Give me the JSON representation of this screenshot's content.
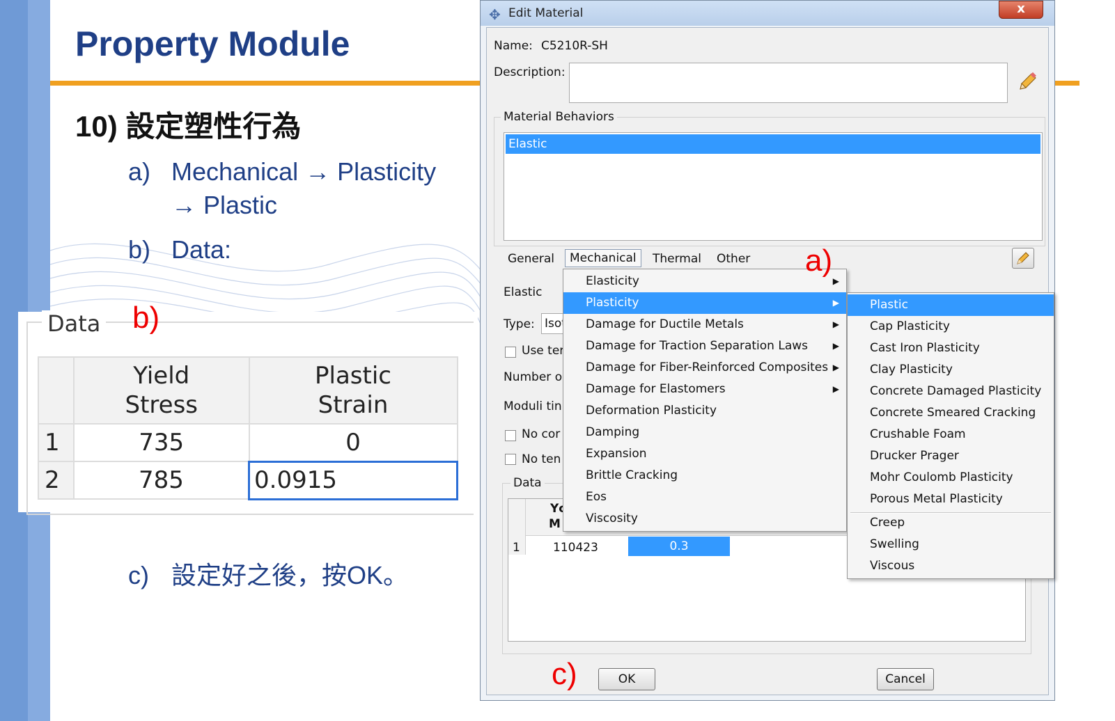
{
  "slide": {
    "title": "Property Module",
    "heading": "10) 設定塑性行為",
    "steps": [
      {
        "marker": "a)",
        "text_line1": "Mechanical → Plasticity",
        "text_line2": "→ Plastic"
      },
      {
        "marker": "b)",
        "text": "Data:"
      },
      {
        "marker": "c)",
        "text": "設定好之後，按OK。"
      }
    ],
    "callouts": {
      "a": "a)",
      "b": "b)",
      "c": "c)"
    }
  },
  "data_snippet": {
    "legend": "Data",
    "headers": [
      "Yield\nStress",
      "Plastic\nStrain"
    ],
    "rows": [
      {
        "index": "1",
        "yield_stress": "735",
        "plastic_strain": "0"
      },
      {
        "index": "2",
        "yield_stress": "785",
        "plastic_strain": "0.0915"
      }
    ]
  },
  "dialog": {
    "title": "Edit Material",
    "close_label": "x",
    "name_label": "Name:",
    "name_value": "C5210R-SH",
    "description_label": "Description:",
    "description_value": "",
    "behaviors_legend": "Material Behaviors",
    "behaviors": [
      "Elastic"
    ],
    "menu_tabs": [
      "General",
      "Mechanical",
      "Thermal",
      "Other"
    ],
    "elastic_section": {
      "legend": "Elastic",
      "type_label": "Type:",
      "type_value": "Isot",
      "use_temp_label": "Use ter",
      "number_label": "Number o",
      "moduli_label": "Moduli tin",
      "no_compression_label": "No cor",
      "no_tension_label": "No ten",
      "data_legend": "Data",
      "col_header_line1": "Yc",
      "col_header_line2": "M",
      "row_index": "1",
      "youngs_modulus": "110423",
      "poissons_ratio": "0.3"
    },
    "ok_label": "OK",
    "cancel_label": "Cancel"
  },
  "mechanical_menu": {
    "items": [
      {
        "label": "Elasticity",
        "submenu": true
      },
      {
        "label": "Plasticity",
        "submenu": true,
        "selected": true
      },
      {
        "label": "Damage for Ductile Metals",
        "submenu": true
      },
      {
        "label": "Damage for Traction Separation Laws",
        "submenu": true
      },
      {
        "label": "Damage for Fiber-Reinforced Composites",
        "submenu": true
      },
      {
        "label": "Damage for Elastomers",
        "submenu": true
      },
      {
        "label": "Deformation Plasticity",
        "submenu": false
      },
      {
        "label": "Damping",
        "submenu": false
      },
      {
        "label": "Expansion",
        "submenu": false
      },
      {
        "label": "Brittle Cracking",
        "submenu": false
      },
      {
        "label": "Eos",
        "submenu": false
      },
      {
        "label": "Viscosity",
        "submenu": false
      }
    ]
  },
  "plasticity_submenu": {
    "items": [
      {
        "label": "Plastic",
        "selected": true
      },
      {
        "label": "Cap Plasticity"
      },
      {
        "label": "Cast Iron Plasticity"
      },
      {
        "label": "Clay Plasticity"
      },
      {
        "label": "Concrete Damaged Plasticity"
      },
      {
        "label": "Concrete Smeared Cracking"
      },
      {
        "label": "Crushable Foam"
      },
      {
        "label": "Drucker Prager"
      },
      {
        "label": "Mohr Coulomb Plasticity"
      },
      {
        "label": "Porous Metal Plasticity"
      },
      {
        "label": "Creep"
      },
      {
        "label": "Swelling"
      },
      {
        "label": "Viscous"
      }
    ]
  },
  "icons": {
    "app": "abaqus-icon",
    "edit_description": "pencil-icon",
    "edit_behavior": "pencil-icon",
    "submenu": "triangle-right-icon"
  }
}
